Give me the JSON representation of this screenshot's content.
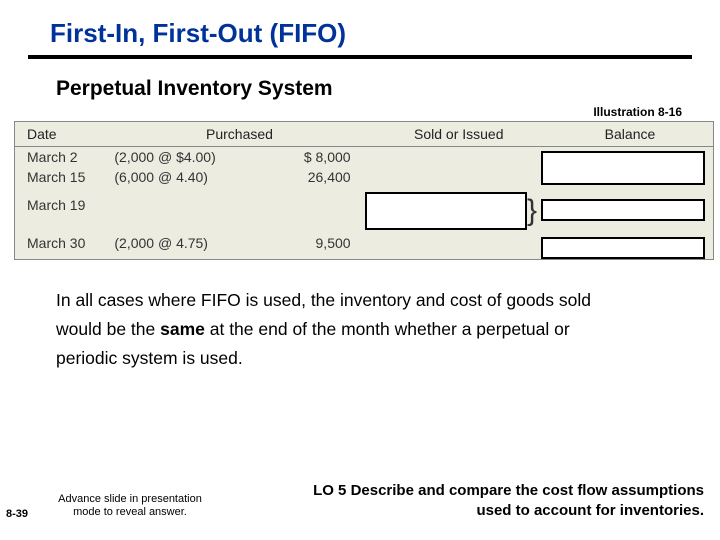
{
  "title": "First-In, First-Out (FIFO)",
  "subtitle": "Perpetual Inventory System",
  "illustration": "Illustration 8-16",
  "table": {
    "headers": {
      "date": "Date",
      "purchased": "Purchased",
      "sold": "Sold or Issued",
      "balance": "Balance"
    },
    "rows": [
      {
        "date": "March 2",
        "purch": "(2,000 @ $4.00)",
        "amt": "$  8,000"
      },
      {
        "date": "March 15",
        "purch": "(6,000 @   4.40)",
        "amt": "26,400"
      },
      {
        "date": "March 19",
        "purch": "",
        "amt": ""
      },
      {
        "date": "",
        "purch": "",
        "amt": ""
      },
      {
        "date": "March 30",
        "purch": "(2,000 @   4.75)",
        "amt": "9,500"
      }
    ]
  },
  "body": {
    "l1": "In all cases where FIFO is used, the inventory and cost of goods sold",
    "l2a": "would be the ",
    "l2b": "same",
    "l2c": " at the end of the month whether a perpetual or",
    "l3": "periodic system is used."
  },
  "footer": {
    "pgnum": "8-39",
    "advance_l1": "Advance slide in presentation",
    "advance_l2": "mode to reveal answer.",
    "lo_l1": "LO 5  Describe and compare the cost flow assumptions",
    "lo_l2": "used to account for inventories."
  }
}
